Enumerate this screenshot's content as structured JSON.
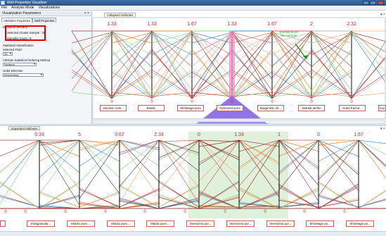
{
  "window": {
    "title": "Well Properties Visualizer"
  },
  "menu": [
    "File",
    "Analysis Mode",
    "Visualizations"
  ],
  "left_panel": {
    "title": "Visualization Parameters",
    "tabs": [
      "Attributes Properties",
      "Well Properties"
    ],
    "selection_header": "Details on demand",
    "selected_cluster_sample": "Selected Cluster Sample : 25",
    "samples_count": "Samples Count : 8",
    "stat_header": "Statistical Classification",
    "selected_field_label": "Selected Field",
    "selected_field_value": "25",
    "attr_order_label": "Attribute Statistical Ordering Method",
    "attr_order_value": "Variance",
    "order_direction_label": "Order Direction",
    "order_direction_value": "descending"
  },
  "upper_view": {
    "tab_label": "Collapsed Attributes",
    "top_values": [
      "1.33",
      "1.33",
      "1.67",
      "1.33",
      "1.67",
      "2",
      "2.32"
    ],
    "bottom_values": [
      "0",
      "0",
      "0",
      "0",
      "0",
      "0",
      "0"
    ],
    "labels": [
      "Volcanic rock...",
      "Biotite",
      "Shrinkage pore",
      "Oversized pore",
      "Diagenetic inf...",
      "Detrital peritin",
      "Grain fractur...",
      "Car"
    ],
    "annotation": "pointer is on the sample",
    "colors": {
      "highlight": "#f08ec3",
      "triangle": "#8b63e8"
    }
  },
  "lower_view": {
    "tab_label": "Expanded Attributes",
    "top_values": [
      "0.33",
      "5",
      "0.67",
      "2.33",
      "0",
      "1.33",
      "1",
      "0",
      "1.67"
    ],
    "bottom_values": [
      "0",
      "0",
      "0",
      "0",
      "0",
      "0",
      "0",
      "0",
      "0",
      "0"
    ],
    "labels": [
      "Intragranular...",
      "Moldic pore....",
      "Moldic pore....",
      "Moldic pore....",
      "Oversized por...",
      "Oversized por...",
      "Oversized por...",
      "Shrinkage po...",
      "Shrinkage po..."
    ],
    "colors": {
      "selection": "#dcefd6"
    }
  }
}
